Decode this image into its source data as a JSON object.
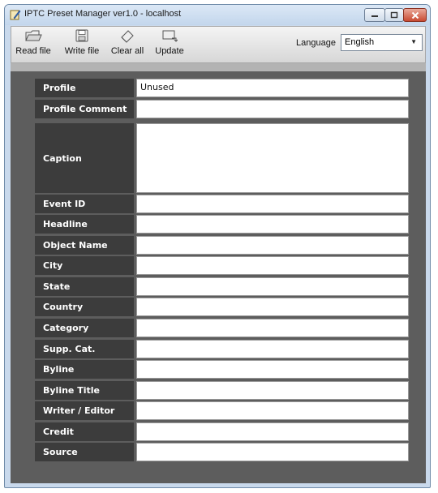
{
  "window": {
    "title": "IPTC Preset Manager ver1.0 - localhost"
  },
  "toolbar": {
    "read_file": "Read file",
    "write_file": "Write file",
    "clear_all": "Clear all",
    "update": "Update",
    "language_label": "Language",
    "language_value": "English"
  },
  "fields": [
    {
      "label": "Profile",
      "value": "Unused"
    },
    {
      "label": "Profile Comment",
      "value": ""
    },
    {
      "label": "Caption",
      "value": ""
    },
    {
      "label": "Event ID",
      "value": ""
    },
    {
      "label": "Headline",
      "value": ""
    },
    {
      "label": "Object Name",
      "value": ""
    },
    {
      "label": "City",
      "value": ""
    },
    {
      "label": "State",
      "value": ""
    },
    {
      "label": "Country",
      "value": ""
    },
    {
      "label": "Category",
      "value": ""
    },
    {
      "label": "Supp. Cat.",
      "value": ""
    },
    {
      "label": "Byline",
      "value": ""
    },
    {
      "label": "Byline Title",
      "value": ""
    },
    {
      "label": "Writer / Editor",
      "value": ""
    },
    {
      "label": "Credit",
      "value": ""
    },
    {
      "label": "Source",
      "value": ""
    }
  ]
}
